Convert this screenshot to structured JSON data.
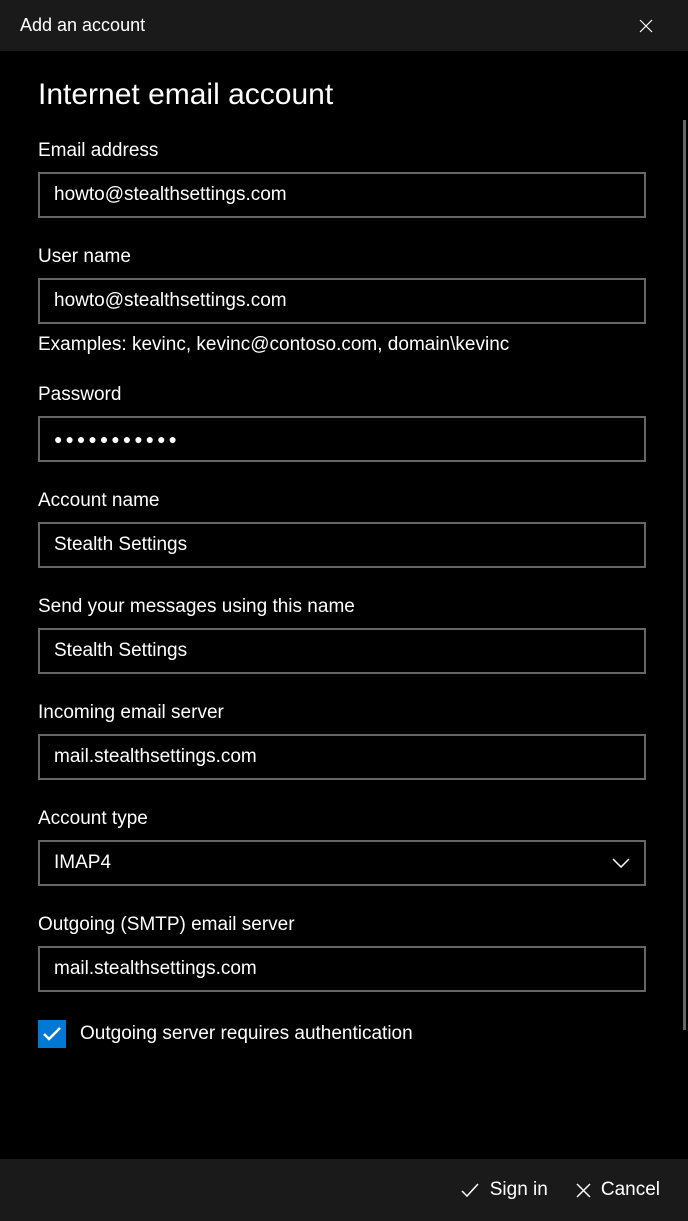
{
  "titlebar": {
    "title": "Add an account"
  },
  "heading": "Internet email account",
  "fields": {
    "email": {
      "label": "Email address",
      "value": "howto@stealthsettings.com"
    },
    "username": {
      "label": "User name",
      "value": "howto@stealthsettings.com",
      "help": "Examples: kevinc, kevinc@contoso.com, domain\\kevinc"
    },
    "password": {
      "label": "Password",
      "value": "●●●●●●●●●●●"
    },
    "account_name": {
      "label": "Account name",
      "value": "Stealth Settings"
    },
    "send_name": {
      "label": "Send your messages using this name",
      "value": "Stealth Settings"
    },
    "incoming": {
      "label": "Incoming email server",
      "value": "mail.stealthsettings.com"
    },
    "account_type": {
      "label": "Account type",
      "value": "IMAP4"
    },
    "outgoing": {
      "label": "Outgoing (SMTP) email server",
      "value": "mail.stealthsettings.com"
    }
  },
  "checkbox": {
    "outgoing_auth": {
      "label": "Outgoing server requires authentication",
      "checked": true
    }
  },
  "footer": {
    "signin": "Sign in",
    "cancel": "Cancel"
  }
}
